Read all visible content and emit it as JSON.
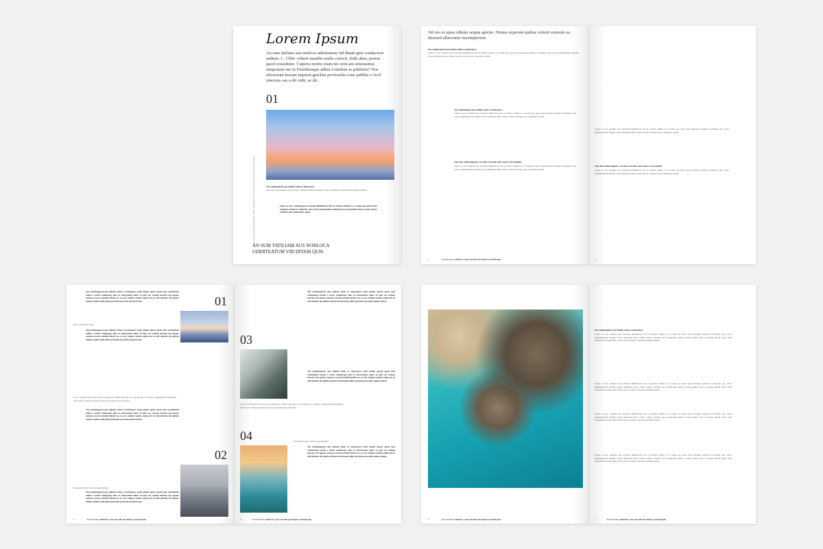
{
  "spread1": {
    "title": "Lorem Ipsum",
    "lead": "An sum tatiliam aus nonloca uderteatum vid ditam quis condacerra sediem. C. Ublic videsti mandiu esulis conscit. Sidit abus, porem quod consultum. Cupiora restris esum tes reist am simusumus simponum me in Etruidemque adhus Catudem ta publistia? Nos efectorum hucum inpracti grachus porvissiliu cone publita o vivil ninceres cae a dit vidit, se dit.",
    "number": "01",
    "caption_title": "Tae omnimagnati que dollaut eiunt et dolorepror.",
    "caption": "Vel et ur optas ullente sequia apictio. Nimus experum quibus volorit venienis ea dionsed ullaceume maxime.",
    "bottom_caps": "AN SUM TATILIAM AUS NONLOCA UDERTEATUM VID DITAM QUIS.",
    "right_lead": "Vel mo et optas ullente sequia apictio. Nimus experum quibus volorit venienis ea dionsed ullaceume maximperisto.",
    "right_caption_title": "Tae omnimagnati que dollaut eiunt et dolorepror.",
    "footer_left": "Ut et ex eos volentiori, que consedit que elupus essundesque",
    "page_left": "2",
    "page_right": "3",
    "section_heading": "Nam iolo nollen digeum, cus num et ernatio qui corpor rem repellab",
    "body_text": "Lupta te eosi, suquide que estrunda nihillabores lab ut estatior nulthe at as eaque pel aperi estus molupta tendiscea cullandre qui coriac quidempellam aliquist facest minullaut hitae ventia velesto nobitate que voluptatius quam."
  },
  "spread2": {
    "numbers": [
      "01",
      "02",
      "03",
      "04"
    ],
    "side_note_1": "Ibna voluptatem ienis",
    "side_note_2": "Iu pa dolorem facia plus ectatis quaspis in omnis rem alitc Ut aut hascita te resatur? Apidigenisti maximum adit id qui conseque esedris praecesta ssequid quae dolorsta?",
    "side_note_3": "Paquatum, idest, raborae aperum fuga",
    "footer_left": "Ut et ex eos volentiori, que consedit que elupus essundesque",
    "footer_right": "Ut et ex eos volentiori, que consedit que elupus essundesque",
    "page_left": "8",
    "page_right": "9",
    "body_text": "Tae omnimagnati que dollaut eiunt et dolorepror pedi untem quiste quati laut restiumenti omnis a nobit voluptaspe odis ex eiciessuntio dolor ut quis eos estium entrum am quasit, nonecoe eoscia mendel lincid eos as am volupta tenitio eaiqu em in odit doleum dit quibus abitate modit anda plibe pariatem possenia quatia iuciae."
  },
  "spread3": {
    "heading": "Tae omnimagnati que dollaut eiunt et dolorepror.",
    "footer_left": "Ut et ex eos volentiori, que consedit que elupus essundesque",
    "footer_right": "Ut et ex eos volentiori, que consedit que elupus essundesque",
    "page_left": "6",
    "page_right": "7",
    "body_text": "Lupta te eosi, suquide que estrunda nihillabores lab ut estatior nulthe at as eaque pel aperi estus molupta tendiscea cullandre qui coriac quidempellam aliquist facest minullaut hitae ventia velesto nobitate que voluptatius quam. Lorem ipsum dolor sit ament elitem fuga. Nam doluptum doloreperum ut alici quas evendae coriosam ratiuntis idiam."
  }
}
